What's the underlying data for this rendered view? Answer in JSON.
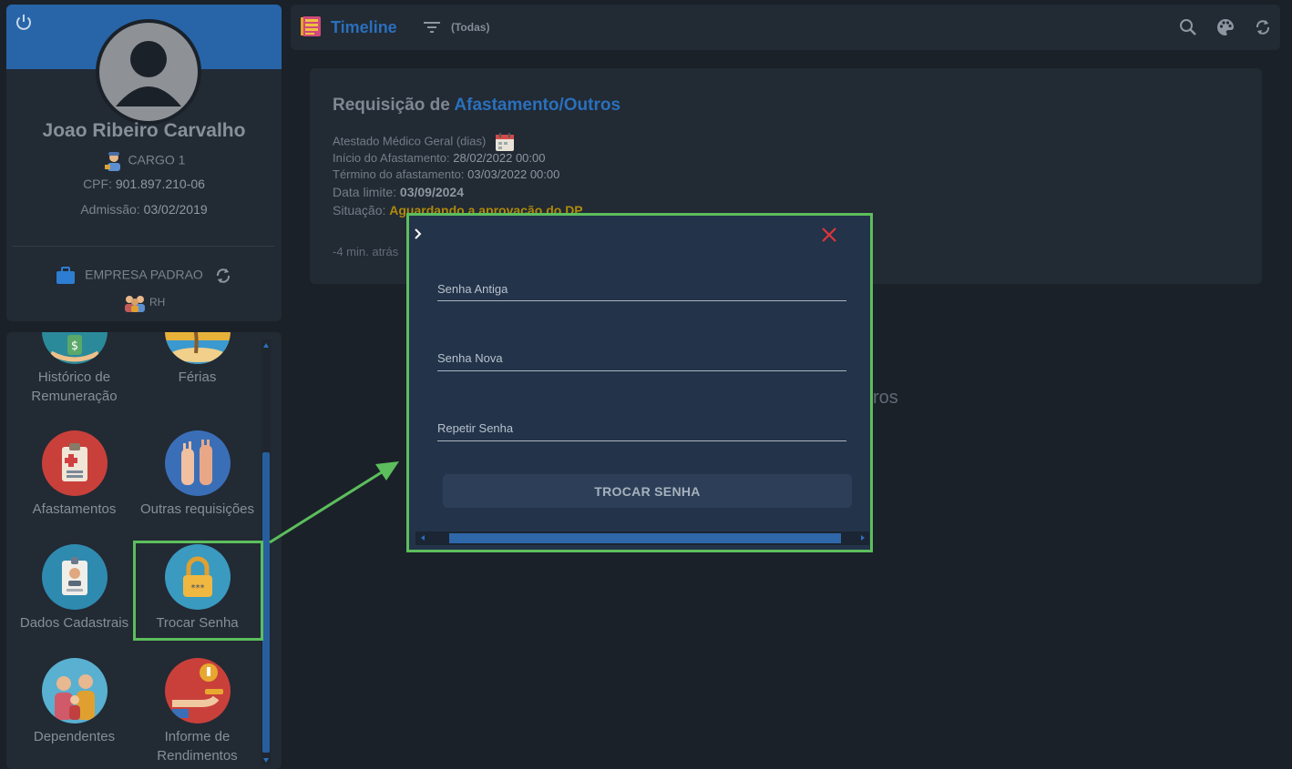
{
  "profile": {
    "name": "Joao Ribeiro Carvalho",
    "cargo": "CARGO 1",
    "cpf_label": "CPF:",
    "cpf_value": "901.897.210-06",
    "admissao_label": "Admissão:",
    "admissao_value": "03/02/2019",
    "empresa": "EMPRESA PADRAO",
    "setor": "RH",
    "banner_color": "#2765a8"
  },
  "menu": {
    "items": [
      {
        "label": "Histórico de Remuneração",
        "icon": "money-hand-icon"
      },
      {
        "label": "Férias",
        "icon": "beach-icon"
      },
      {
        "label": "Afastamentos",
        "icon": "clipboard-icon"
      },
      {
        "label": "Outras requisições",
        "icon": "raised-hands-icon"
      },
      {
        "label": "Dados Cadastrais",
        "icon": "id-badge-icon"
      },
      {
        "label": "Trocar Senha",
        "icon": "padlock-icon"
      },
      {
        "label": "Dependentes",
        "icon": "family-icon"
      },
      {
        "label": "Informe de Rendimentos",
        "icon": "coin-hand-icon"
      }
    ]
  },
  "topbar": {
    "title": "Timeline",
    "filter": "(Todas)",
    "accent": "#2a70bc"
  },
  "request": {
    "title_prefix": "Requisição de",
    "title_type": "Afastamento/Outros",
    "subtype": "Atestado Médico Geral (dias)",
    "inicio_label": "Início do Afastamento:",
    "inicio_value": "28/02/2022 00:00",
    "termino_label": "Término do afastamento:",
    "termino_value": "03/03/2022 00:00",
    "limite_label": "Data limite:",
    "limite_value": "03/09/2024",
    "situacao_label": "Situação:",
    "situacao_value": "Aguardando a aprovação do DP",
    "time": "-4 min. atrás",
    "status_color": "#b08a0a"
  },
  "background_text": "ros",
  "modal": {
    "fields": [
      "Senha Antiga",
      "Senha Nova",
      "Repetir Senha"
    ],
    "button": "TROCAR SENHA",
    "border_color": "#5cbe5c",
    "close_color": "#e0343a"
  }
}
